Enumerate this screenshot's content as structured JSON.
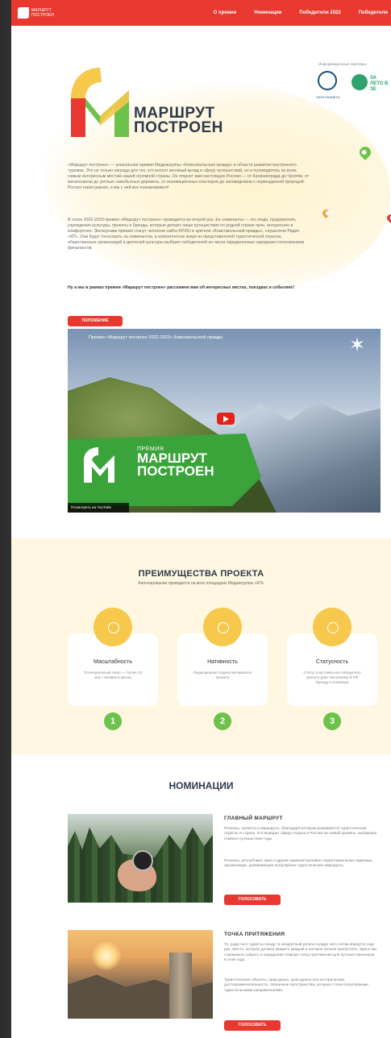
{
  "topbar": {
    "logo_text": "МАРШРУТ ПОСТРОЕН",
    "nav": [
      "О премии",
      "Номинации",
      "Победители 2022",
      "Победители"
    ]
  },
  "hero": {
    "brand_line1": "МАРШРУТ",
    "brand_line2": "ПОСТРОЕН",
    "partners_title": "Информационные партнеры",
    "partner1": "МОЯ ПЛАНЕТА",
    "partner2": "ЗА ЛЕТО В ЗЕ",
    "para1": "«Маршрут построен» — уникальная премия Медиагруппы «Комсомольская правда» в области развития внутреннего туризма. Это не только награда для тех, кто вносит весомый вклад в сферу путешествий, но и путеводитель по всем самым интересным местам нашей огромной страны. Он откроет вам настоящую Россию — от Калининграда до Чукотки, от мегаполисов до уютных самобытных деревень, от инновационных кластеров до заповедников с первозданной природой. Россия такая разная, и мы с ней все познакомимся!",
    "para2": "В сезон 2022-2023 премия «Маршрут построен» проводится во второй раз. Ее номинанты — это люди, предприятия, учреждения культуры, проекты и бренды, которые делают наши путешествия по родной стране ярче, интереснее и комфортнее. Экспертами премии станут читатели сайта KP.RU и зрители «Комсомольской правды», слушатели Радио «КП». Они будут голосовать за номинантов, а компетентное жюри из представителей туристической отрасли, общественных организаций и деятелей культуры выберет победителей из числа определенных народным голосованием финалистов.",
    "para3": "Ну а мы в рамках премии «Маршрут построен» расскажем вам об интересных местах, поездках и событиях!",
    "button": "ПОЛОЖЕНИЕ"
  },
  "video": {
    "title": "Премия «Маршрут построен 2022-2023» Комсомольской правды",
    "brand_small": "ПРЕМИЯ",
    "brand_line1": "МАРШРУТ",
    "brand_line2": "ПОСТРОЕН",
    "watch": "Посмотреть на YouTube"
  },
  "advantages": {
    "title": "ПРЕИМУЩЕСТВА ПРОЕКТА",
    "subtitle": "Анонсирование проводится на всех площадках Медиагруппы «КП»",
    "cards": [
      {
        "title": "Масштабность",
        "desc": "Потенциальный охват — более 10 млн. человек в месяц",
        "num": "1"
      },
      {
        "title": "Нативность",
        "desc": "Редакционная подача материалов проекта",
        "num": "2"
      },
      {
        "title": "Статусность",
        "desc": "Статус участника или победителя проекта дает поклоннику В РФ Бренду и компании",
        "num": "3"
      }
    ]
  },
  "nominations": {
    "title": "НОМИНАЦИИ",
    "items": [
      {
        "name": "ГЛАВНЫЙ МАРШРУТ",
        "desc1": "Регионы, проекты и маршруты, благодаря которым развивается туристическая отрасль в стране. Кто выводит сферу отдыха в России на новый уровень: выбираем главное путешествие года.",
        "desc2": "Регионы, республики, края и другие административно-территориальные единицы, организации, развивающие популярные туристические маршруты.",
        "button": "ГОЛОСОВАТЬ"
      },
      {
        "name": "ТОЧКА ПРИТЯЖЕНИЯ",
        "desc1": "То, ради чего туристы поедут в конкретный регион и ради чего потом вернутся еще раз. Место, которое должен увидеть каждый и которое нельзя пропустить. Здесь мы стремимся собрать и определим главную точку притяжения для путешественников в этом году.",
        "desc2": "Туристические объекты, природные, культурные или исторические, достопримечательности, связанные пространства, которые стали популярными туристическими направлениями.",
        "button": "ГОЛОСОВАТЬ"
      }
    ]
  },
  "colors": {
    "red": "#e8382f",
    "yellow": "#f6c84c",
    "green": "#6cc24a",
    "navy": "#2f3a4a"
  }
}
